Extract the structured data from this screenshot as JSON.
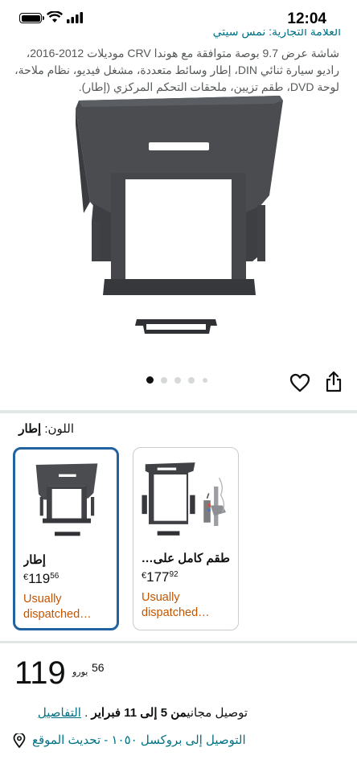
{
  "status_bar": {
    "time": "12:04",
    "icons": [
      "battery-icon",
      "wifi-icon",
      "signal-icon"
    ]
  },
  "product": {
    "brand_line": "العلامة التجارية: نمس سيتي",
    "description": "شاشة عرض 9.7 بوصة متوافقة مع هوندا CRV موديلات 2012-2016، راديو سيارة ثنائي DIN، إطار وسائط متعددة، مشغل فيديو، نظام ملاحة، لوحة DVD، طقم تزيين، ملحقات التحكم المركزي (إطار).",
    "image_count": 5,
    "active_image": 1
  },
  "actions": {
    "share_icon": "share-icon",
    "wishlist_icon": "heart-icon"
  },
  "color_selector": {
    "label": "اللون:",
    "selected_value": "إطار"
  },
  "swatches": [
    {
      "name": "إطار",
      "currency": "€",
      "price_whole": "119",
      "price_fraction": "56",
      "availability": "Usually dispatched…",
      "selected": true
    },
    {
      "name": "طقم كامل على…",
      "currency": "€",
      "price_whole": "177",
      "price_fraction": "92",
      "availability": "Usually dispatched…",
      "selected": false
    }
  ],
  "price": {
    "whole": "119",
    "fraction": "56",
    "currency": "يورو"
  },
  "delivery": {
    "text": "توصيل مجاني",
    "dates": "من 5 إلى 11 فبراير",
    "details_link": "التفاصيل"
  },
  "location": {
    "text": "التوصيل إلى بروكسل ١٠٥٠ - تحديث الموقع",
    "icon": "location-pin-icon"
  },
  "colors": {
    "link": "#007185",
    "availability": "#c45500",
    "selected_border": "#2162a1",
    "separator": "#e3e6e6"
  }
}
